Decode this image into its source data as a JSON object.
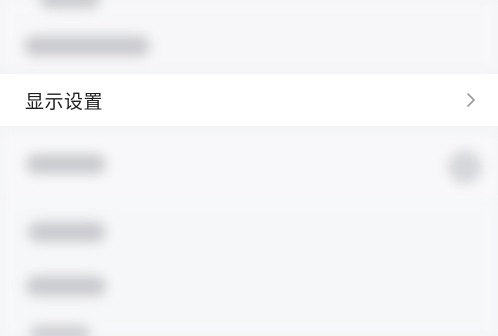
{
  "settings": {
    "display_settings_label": "显示设置",
    "chevron_icon": "chevron-right-icon"
  },
  "colors": {
    "background": "#f3f4f6",
    "row_background": "#ffffff",
    "label_text": "#1f1f1f",
    "chevron": "#9a9a9a"
  }
}
